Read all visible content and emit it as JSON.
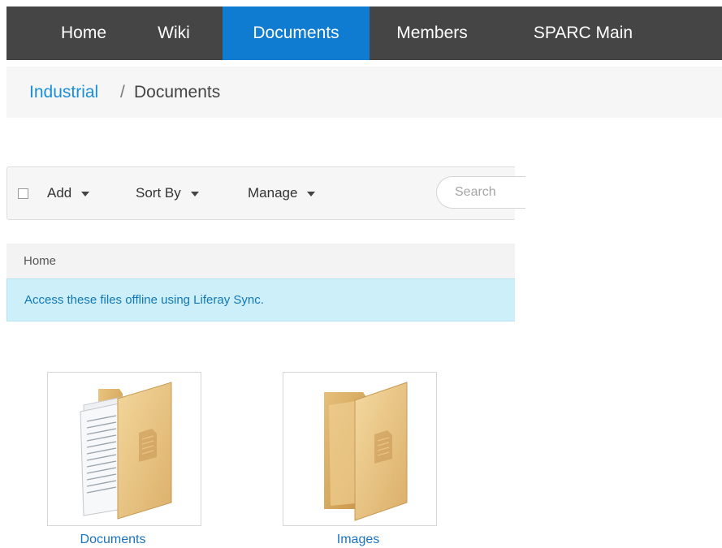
{
  "nav": {
    "items": [
      {
        "label": "Home",
        "active": false
      },
      {
        "label": "Wiki",
        "active": false
      },
      {
        "label": "Documents",
        "active": true
      },
      {
        "label": "Members",
        "active": false
      },
      {
        "label": "SPARC Main",
        "active": false
      }
    ],
    "active_color": "#0f7bd1",
    "bar_color": "#454545"
  },
  "breadcrumb": {
    "site": "Industrial",
    "separator": "/",
    "page": "Documents"
  },
  "toolbar": {
    "select_all_checked": false,
    "add_label": "Add",
    "sort_label": "Sort By",
    "manage_label": "Manage",
    "search_placeholder": "Search"
  },
  "folder_path": {
    "root": "Home"
  },
  "alert": {
    "message": "Access these files offline using Liferay Sync."
  },
  "folders": [
    {
      "name": "Documents",
      "icon": "folder-with-documents-icon"
    },
    {
      "name": "Images",
      "icon": "folder-icon"
    }
  ]
}
